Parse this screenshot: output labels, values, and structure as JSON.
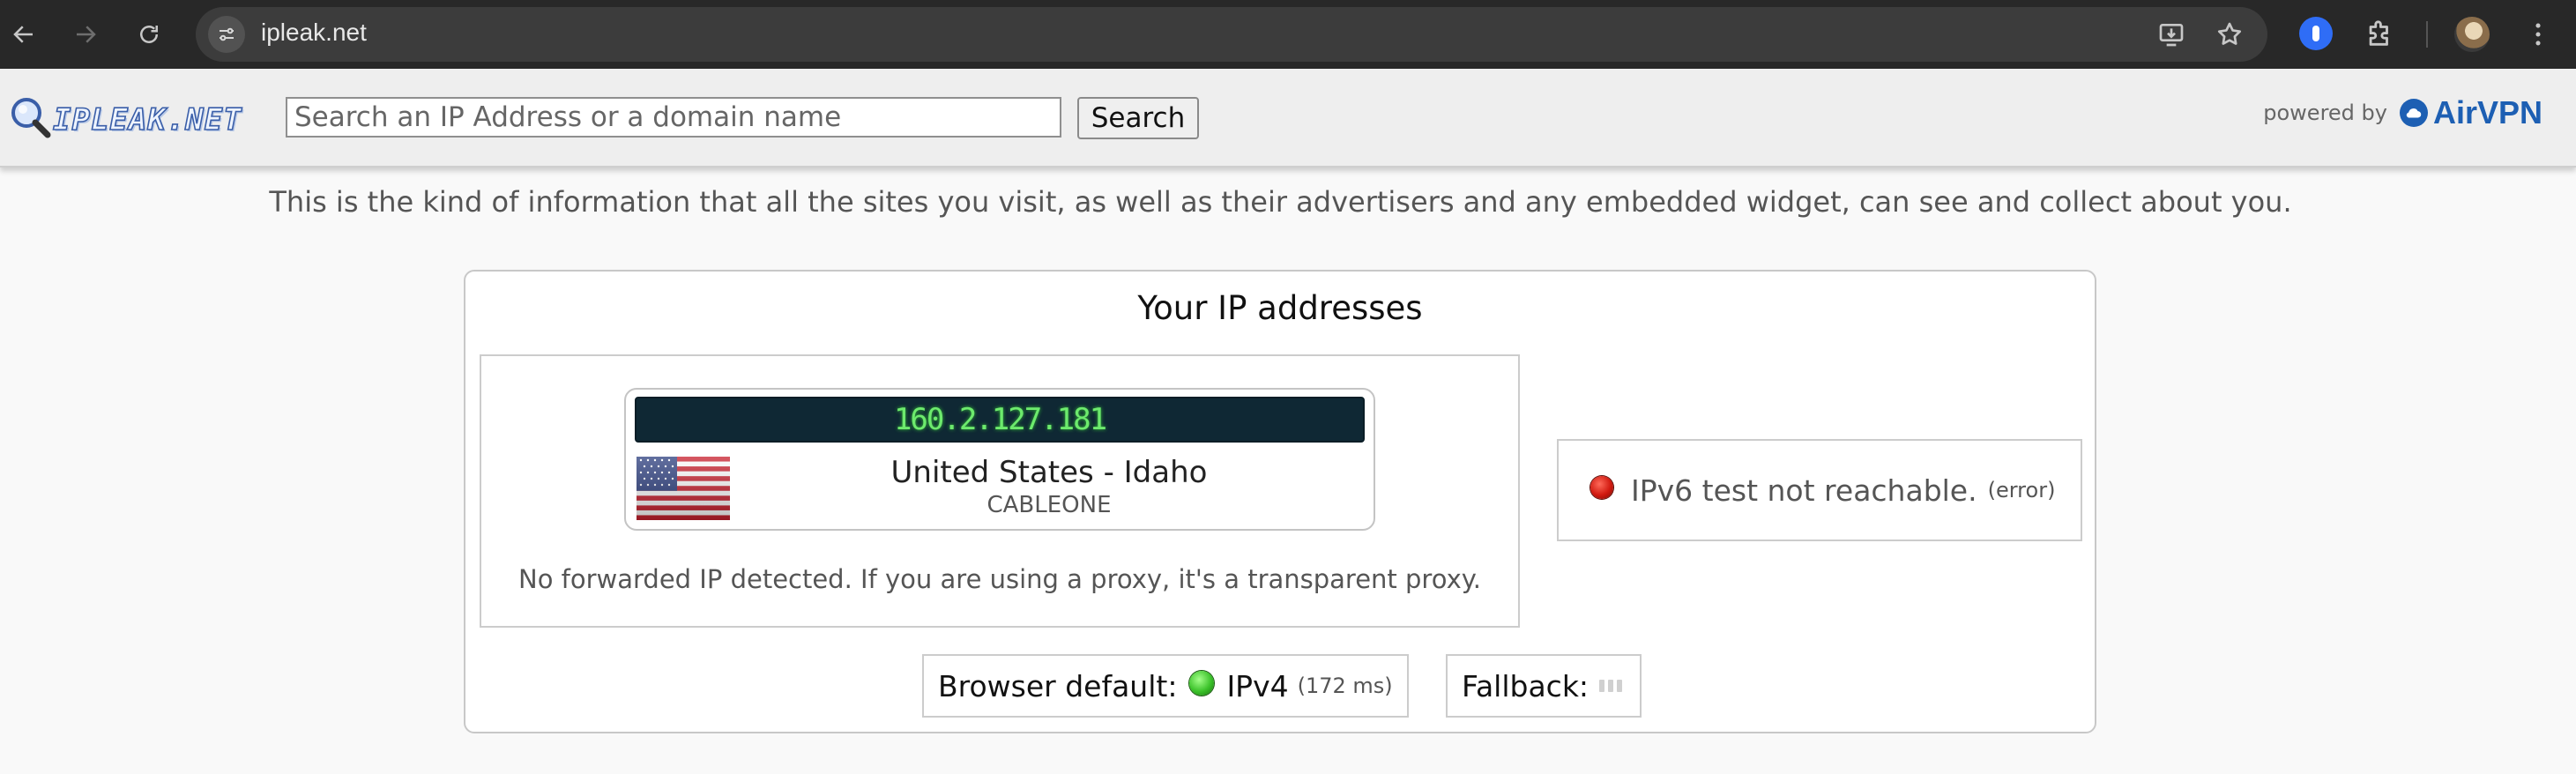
{
  "browser": {
    "url": "ipleak.net"
  },
  "header": {
    "logo_text": "IPLEAK.NET",
    "search_placeholder": "Search an IP Address or a domain name",
    "search_value": "",
    "search_button": "Search",
    "powered_by_label": "powered by",
    "powered_by_brand": "AirVPN"
  },
  "intro_text": "This is the kind of information that all the sites you visit, as well as their advertisers and any embedded widget, can see and collect about you.",
  "ip_panel": {
    "title": "Your IP addresses",
    "ipv4": {
      "address": "160.2.127.181",
      "location": "United States - Idaho",
      "isp": "CABLEONE",
      "flag": "us-flag"
    },
    "forward_note": "No forwarded IP detected. If you are using a proxy, it's a transparent proxy.",
    "ipv6": {
      "status": "IPv6 test not reachable.",
      "detail": "(error)",
      "status_color": "#d11a10"
    },
    "browser_default": {
      "label": "Browser default:",
      "protocol": "IPv4",
      "latency": "(172 ms)",
      "status_color": "#3bc22a"
    },
    "fallback": {
      "label": "Fallback:"
    }
  },
  "colors": {
    "chrome_bg": "#282828",
    "header_bg": "#eeeeee",
    "ip_display_bg": "#0f2834",
    "ip_display_text": "#6dea6d",
    "brand_blue": "#1d5fb3"
  }
}
